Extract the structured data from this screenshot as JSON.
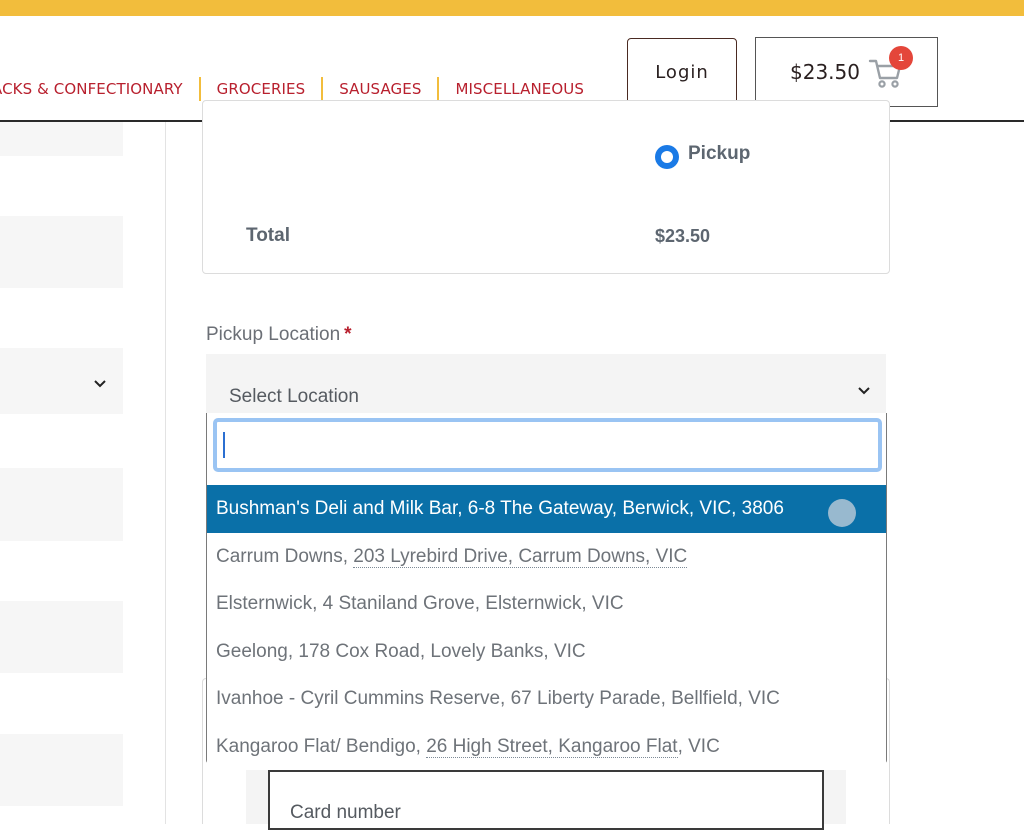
{
  "nav": {
    "items": [
      "ACKS & CONFECTIONARY",
      "GROCERIES",
      "SAUSAGES",
      "MISCELLANEOUS"
    ]
  },
  "header": {
    "login_label": "Login",
    "cart_total": "$23.50",
    "cart_count": "1",
    "cart_icon": "cart-icon"
  },
  "order_summary": {
    "shipping_option": "Pickup",
    "shipping_selected": true,
    "total_label": "Total",
    "total_value": "$23.50"
  },
  "pickup_location": {
    "label": "Pickup Location",
    "required_mark": "*",
    "selected_display": "Select Location",
    "search_value": "",
    "options": [
      "Bushman's Deli and Milk Bar, 6-8 The Gateway, Berwick, VIC, 3806",
      "Carrum Downs, 203 Lyrebird Drive, Carrum Downs, VIC",
      "Elsternwick, 4 Staniland Grove, Elsternwick, VIC",
      "Geelong, 178 Cox Road, Lovely Banks, VIC",
      "Ivanhoe - Cyril Cummins Reserve, 67 Liberty Parade, Bellfield, VIC",
      "Kangaroo Flat/ Bendigo, 26 High Street, Kangaroo Flat, VIC"
    ],
    "option_parts": {
      "carrum_prefix": "Carrum Downs, ",
      "carrum_address": "203 Lyrebird Drive, Carrum Downs, VIC",
      "kangaroo_prefix": "Kangaroo Flat/ Bendigo, ",
      "kangaroo_address": "26 High Street, Kangaroo Flat",
      "kangaroo_suffix": ", VIC"
    },
    "highlighted_index": 0
  },
  "payment": {
    "card_number_placeholder": "Card number"
  },
  "colors": {
    "accent_yellow": "#f2bd3c",
    "nav_red": "#b8202e",
    "highlight_blue": "#0a70a8",
    "radio_blue": "#1a7ae6",
    "badge_red": "#e4463a"
  }
}
